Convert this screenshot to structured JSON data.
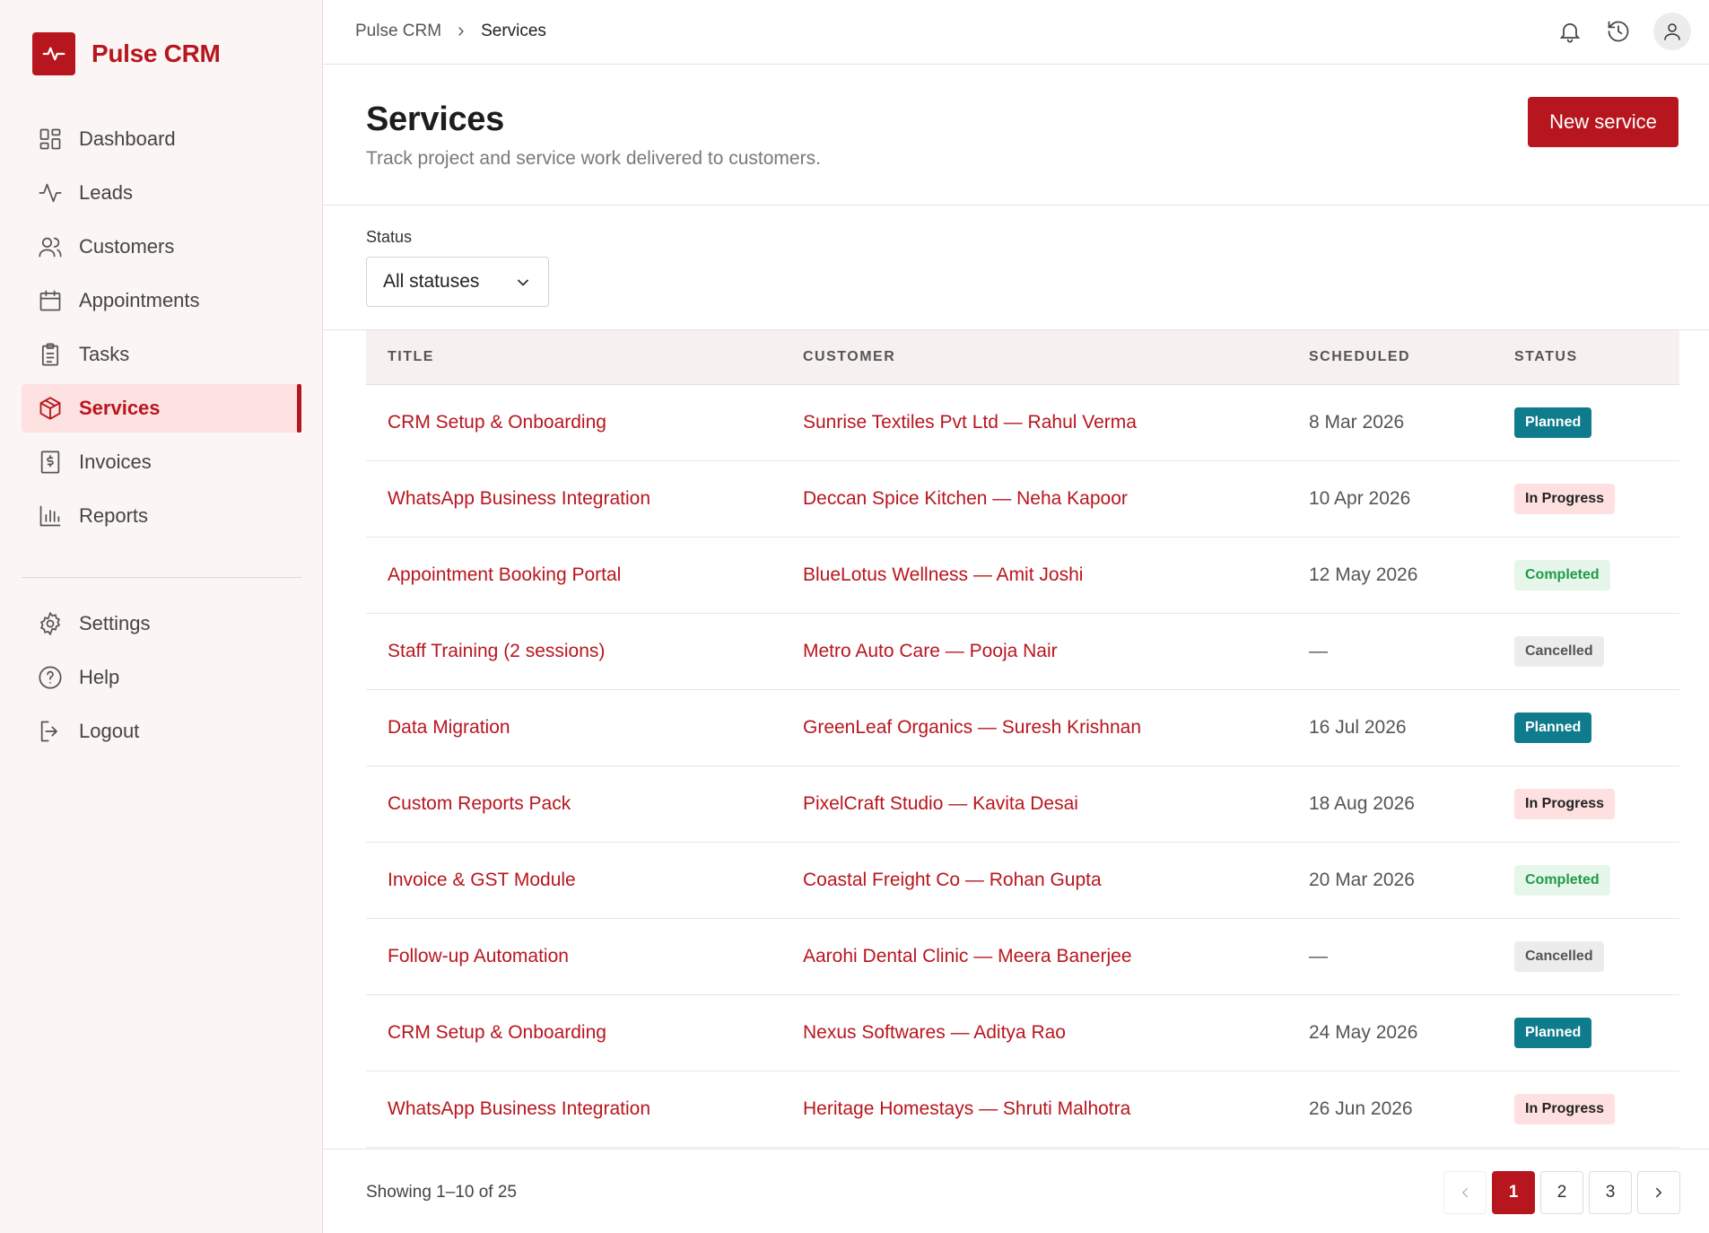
{
  "brand": {
    "name": "Pulse CRM",
    "accent": "#b8161e"
  },
  "sidebar": {
    "items": [
      {
        "label": "Dashboard",
        "icon": "dashboard-icon"
      },
      {
        "label": "Leads",
        "icon": "activity-icon"
      },
      {
        "label": "Customers",
        "icon": "users-icon"
      },
      {
        "label": "Appointments",
        "icon": "calendar-icon"
      },
      {
        "label": "Tasks",
        "icon": "clipboard-icon"
      },
      {
        "label": "Services",
        "icon": "box-icon",
        "active": true
      },
      {
        "label": "Invoices",
        "icon": "invoice-icon"
      },
      {
        "label": "Reports",
        "icon": "bar-chart-icon"
      }
    ],
    "secondary": [
      {
        "label": "Settings",
        "icon": "gear-icon"
      },
      {
        "label": "Help",
        "icon": "help-icon"
      },
      {
        "label": "Logout",
        "icon": "logout-icon"
      }
    ]
  },
  "breadcrumb": {
    "root": "Pulse CRM",
    "current": "Services"
  },
  "header": {
    "title": "Services",
    "subtitle": "Track project and service work delivered to customers.",
    "new_button": "New service"
  },
  "filter": {
    "label": "Status",
    "value": "All statuses"
  },
  "table": {
    "columns": [
      "TITLE",
      "CUSTOMER",
      "SCHEDULED",
      "STATUS"
    ],
    "rows": [
      {
        "title": "CRM Setup & Onboarding",
        "customer": "Sunrise Textiles Pvt Ltd — Rahul Verma",
        "scheduled": "8 Mar 2026",
        "status": "Planned"
      },
      {
        "title": "WhatsApp Business Integration",
        "customer": "Deccan Spice Kitchen — Neha Kapoor",
        "scheduled": "10 Apr 2026",
        "status": "In Progress"
      },
      {
        "title": "Appointment Booking Portal",
        "customer": "BlueLotus Wellness — Amit Joshi",
        "scheduled": "12 May 2026",
        "status": "Completed"
      },
      {
        "title": "Staff Training (2 sessions)",
        "customer": "Metro Auto Care — Pooja Nair",
        "scheduled": "—",
        "status": "Cancelled"
      },
      {
        "title": "Data Migration",
        "customer": "GreenLeaf Organics — Suresh Krishnan",
        "scheduled": "16 Jul 2026",
        "status": "Planned"
      },
      {
        "title": "Custom Reports Pack",
        "customer": "PixelCraft Studio — Kavita Desai",
        "scheduled": "18 Aug 2026",
        "status": "In Progress"
      },
      {
        "title": "Invoice & GST Module",
        "customer": "Coastal Freight Co — Rohan Gupta",
        "scheduled": "20 Mar 2026",
        "status": "Completed"
      },
      {
        "title": "Follow-up Automation",
        "customer": "Aarohi Dental Clinic — Meera Banerjee",
        "scheduled": "—",
        "status": "Cancelled"
      },
      {
        "title": "CRM Setup & Onboarding",
        "customer": "Nexus Softwares — Aditya Rao",
        "scheduled": "24 May 2026",
        "status": "Planned"
      },
      {
        "title": "WhatsApp Business Integration",
        "customer": "Heritage Homestays — Shruti Malhotra",
        "scheduled": "26 Jun 2026",
        "status": "In Progress"
      }
    ]
  },
  "footer": {
    "showing": "Showing 1–10 of 25",
    "pages": [
      "1",
      "2",
      "3"
    ],
    "current_page": "1"
  }
}
